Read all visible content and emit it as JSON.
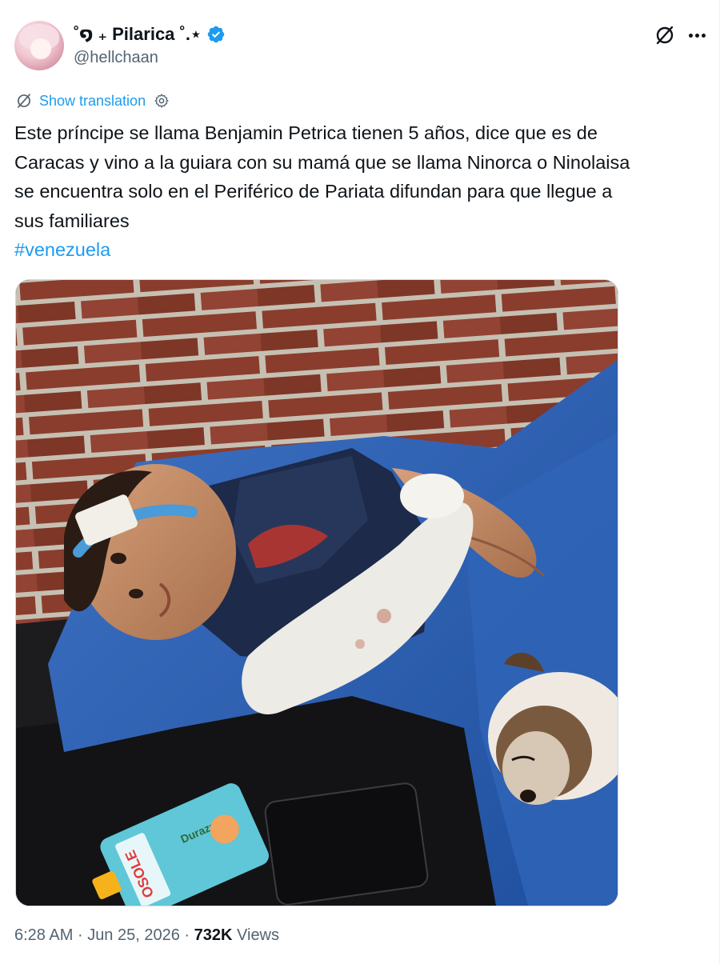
{
  "author": {
    "display_name": "˚໑ ₊ Pilarica ˚.⋆",
    "handle": "@hellchaan",
    "verified_icon": "verified-badge-icon",
    "accent_color": "#1d9bf0"
  },
  "header_actions": {
    "grok_icon": "grok-icon",
    "more_icon": "more-icon"
  },
  "translation": {
    "label": "Show translation",
    "icon": "translate-icon",
    "settings_icon": "gear-icon"
  },
  "tweet": {
    "line1": "Este príncipe se llama Benjamin Petrica tienen 5 años, dice que es de",
    "line2": "Caracas y vino a la guiara con su mamá que se llama Ninorca o Ninolaisa",
    "line3": "se encuentra solo en el Periférico de Pariata difundan para que llegue a",
    "line4": "sus familiares",
    "hashtag": "#venezuela"
  },
  "media": {
    "type": "photo",
    "packet_brand": "OSOLE",
    "packet_flavor": "Durazno"
  },
  "meta": {
    "time": "6:28 AM",
    "separator": "·",
    "date": "Jun 25, 2026",
    "views_count": "732K",
    "views_label": "Views"
  }
}
